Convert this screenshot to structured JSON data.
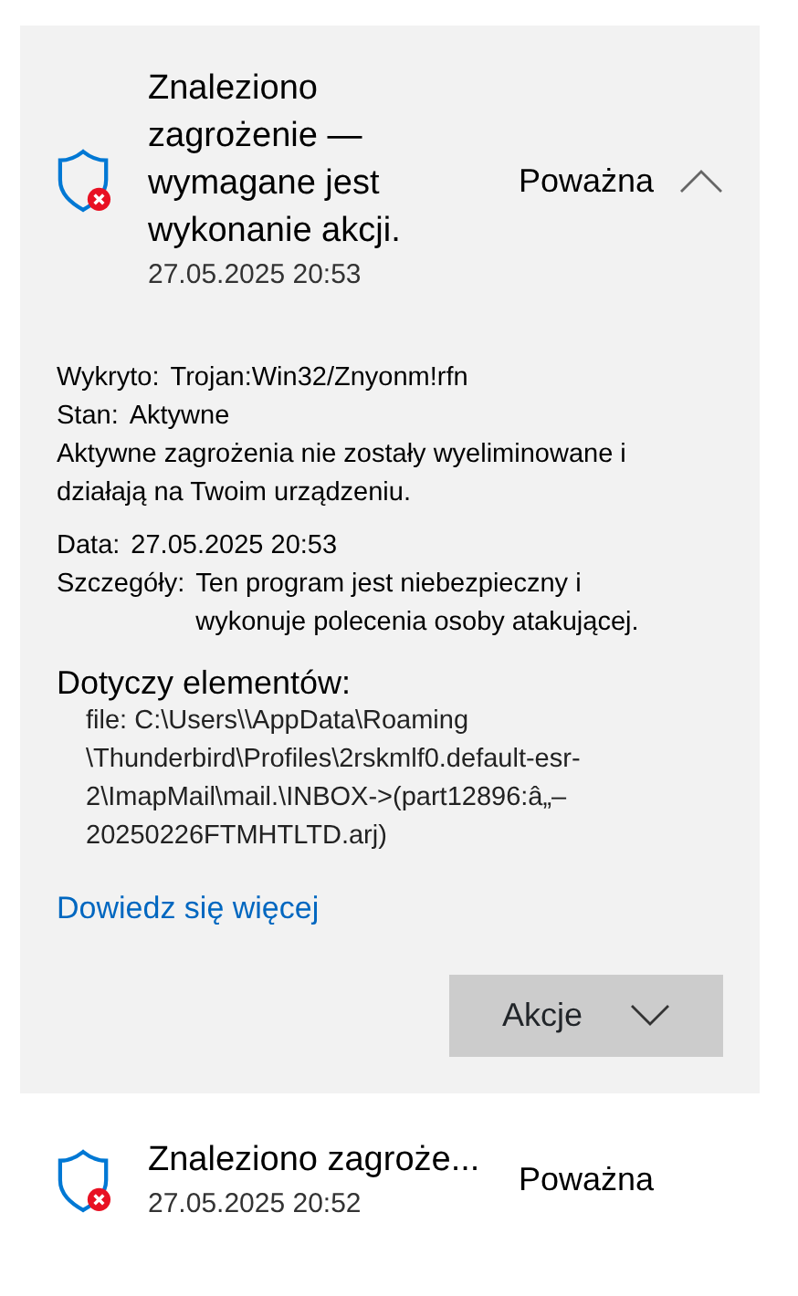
{
  "threats": [
    {
      "title": "Znaleziono zagrożenie — wymagane jest wykonanie akcji.",
      "date": "27.05.2025 20:53",
      "severity": "Poważna",
      "expanded": true,
      "details": {
        "fields": [
          {
            "label": "Wykryto:",
            "value": "Trojan:Win32/Znyonm!rfn"
          },
          {
            "label": "Stan:",
            "value": "Aktywne"
          }
        ],
        "status_note": "Aktywne zagrożenia nie zostały wyeliminowane i działają na Twoim urządzeniu.",
        "fields2": [
          {
            "label": "Data:",
            "value": "27.05.2025 20:53"
          },
          {
            "label": "Szczegóły:",
            "value": "Ten program jest niebezpieczny i wykonuje polecenia osoby atakującej."
          }
        ],
        "affected_heading": "Dotyczy elementów:",
        "affected_items": [
          "file: C:\\Users\\\\AppData\\Roaming \\Thunderbird\\Profiles\\2rskmlf0.default-esr-2\\ImapMail\\mail.\\INBOX->(part12896:â„–20250226FTMHTLTD.arj)"
        ],
        "link": "Dowiedz się więcej",
        "action_button": "Akcje"
      }
    },
    {
      "title": "Znaleziono zagroże...",
      "date": "27.05.2025 20:52",
      "severity": "Poważna",
      "expanded": false
    }
  ]
}
